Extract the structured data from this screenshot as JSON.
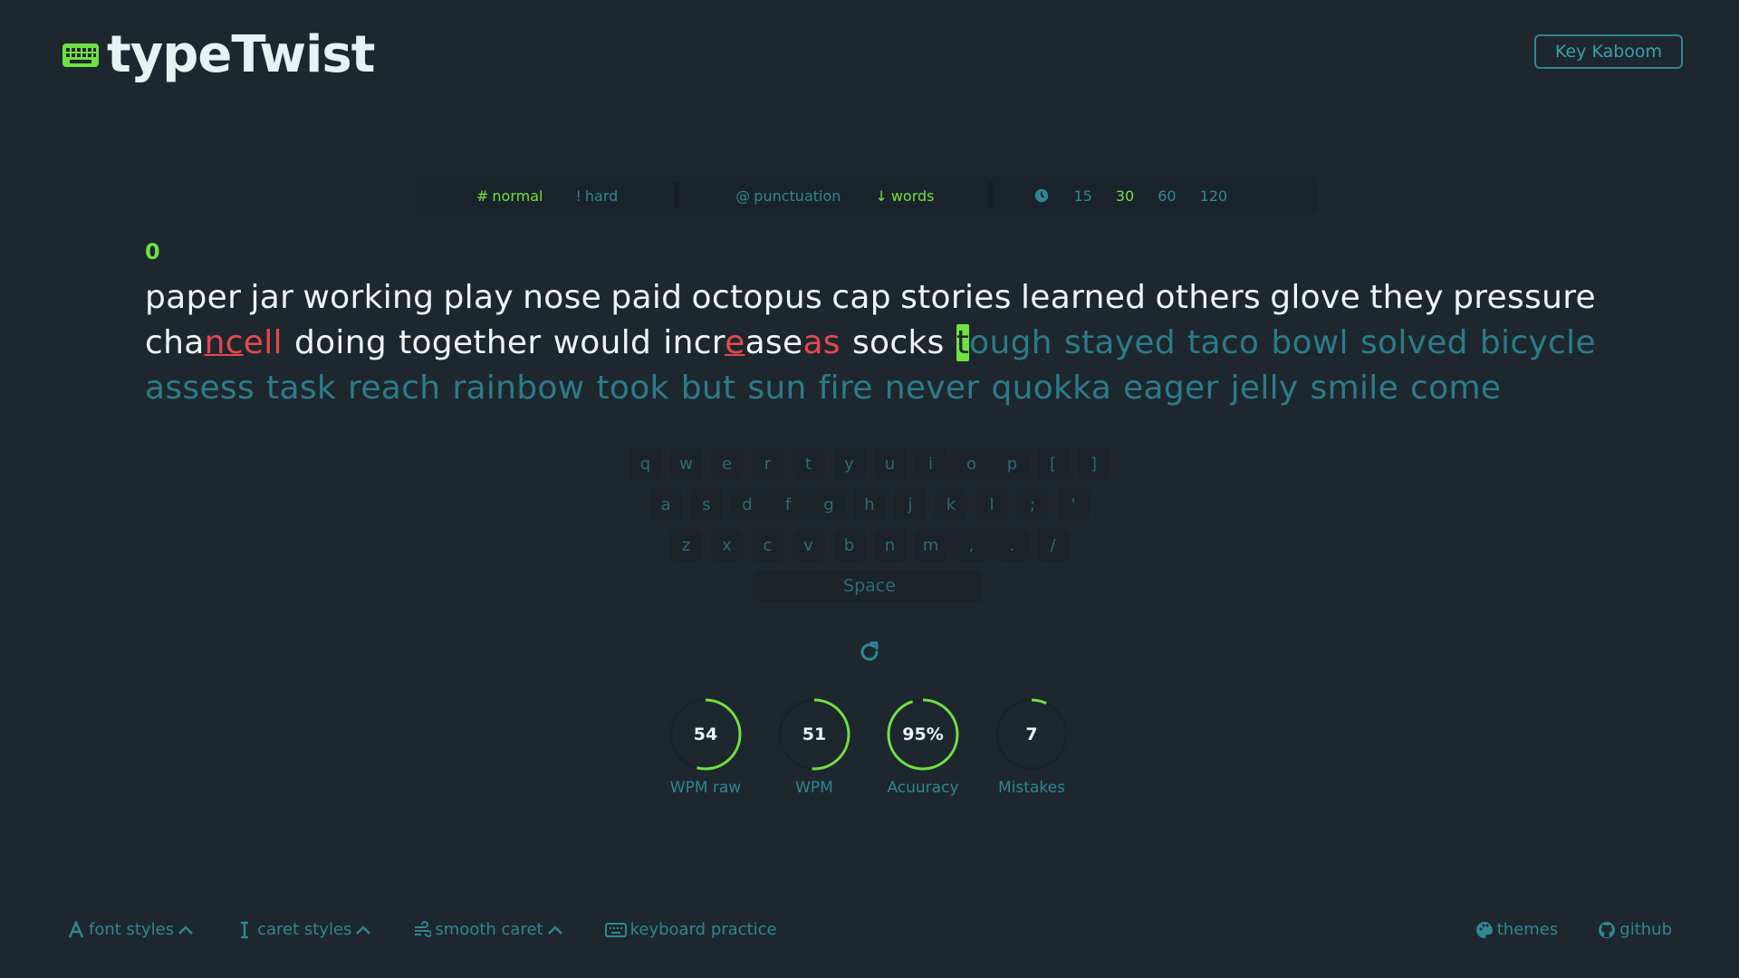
{
  "app": {
    "title": "typeTwist"
  },
  "header": {
    "game_link": "Key Kaboom"
  },
  "modes": {
    "difficulty": [
      {
        "symbol": "#",
        "label": "normal",
        "active": true
      },
      {
        "symbol": "!",
        "label": "hard",
        "active": false
      }
    ],
    "options": [
      {
        "symbol": "@",
        "label": "punctuation",
        "active": false
      },
      {
        "symbol": "↓",
        "label": "words",
        "active": true
      }
    ],
    "times": [
      "15",
      "30",
      "60",
      "120"
    ],
    "active_time": "30"
  },
  "counter": "0",
  "text": {
    "line1": [
      "paper",
      "jar",
      "working",
      "play",
      "nose",
      "paid",
      "octopus",
      "cap",
      "stories",
      "learned",
      "others",
      "glove",
      "they",
      "pressure"
    ],
    "line2_typed": [
      {
        "parts": [
          [
            "cha",
            "typed"
          ],
          [
            "nc",
            "err-u"
          ],
          [
            "e",
            "err"
          ],
          [
            "ll",
            "err"
          ]
        ]
      },
      {
        "parts": [
          [
            "doing",
            "typed"
          ]
        ]
      },
      {
        "parts": [
          [
            "together",
            "typed"
          ]
        ]
      },
      {
        "parts": [
          [
            "would",
            "typed"
          ]
        ]
      },
      {
        "parts": [
          [
            "incr",
            "typed"
          ],
          [
            "e",
            "err-u"
          ],
          [
            "ase",
            "typed"
          ],
          [
            "as",
            "err"
          ]
        ]
      },
      {
        "parts": [
          [
            "socks",
            "typed"
          ]
        ]
      }
    ],
    "current_word": {
      "caret_char": "t",
      "rest": "ough"
    },
    "line2_rest": [
      "stayed",
      "taco",
      "bowl",
      "solved",
      "bicycle"
    ],
    "line3": [
      "assess",
      "task",
      "reach",
      "rainbow",
      "took",
      "but",
      "sun",
      "fire",
      "never",
      "quokka",
      "eager",
      "jelly",
      "smile",
      "come"
    ]
  },
  "keyboard": {
    "rows": [
      [
        "q",
        "w",
        "e",
        "r",
        "t",
        "y",
        "u",
        "i",
        "o",
        "p",
        "[",
        "]"
      ],
      [
        "a",
        "s",
        "d",
        "f",
        "g",
        "h",
        "j",
        "k",
        "l",
        ";",
        "'"
      ],
      [
        "z",
        "x",
        "c",
        "v",
        "b",
        "n",
        "m",
        ",",
        ".",
        "/"
      ]
    ],
    "space_label": "Space"
  },
  "stats": [
    {
      "value": "54",
      "label": "WPM raw",
      "fraction": 0.54
    },
    {
      "value": "51",
      "label": "WPM",
      "fraction": 0.51
    },
    {
      "value": "95%",
      "label": "Acuuracy",
      "fraction": 0.95
    },
    {
      "value": "7",
      "label": "Mistakes",
      "fraction": 0.07
    }
  ],
  "footer": {
    "font_styles": "font styles",
    "caret_styles": "caret styles",
    "smooth_caret": "smooth caret",
    "keyboard_practice": "keyboard practice",
    "themes": "themes",
    "github": "github"
  },
  "colors": {
    "accent": "#70e044",
    "muted": "#2f8794",
    "error": "#e5484d",
    "bg": "#1e272e"
  }
}
